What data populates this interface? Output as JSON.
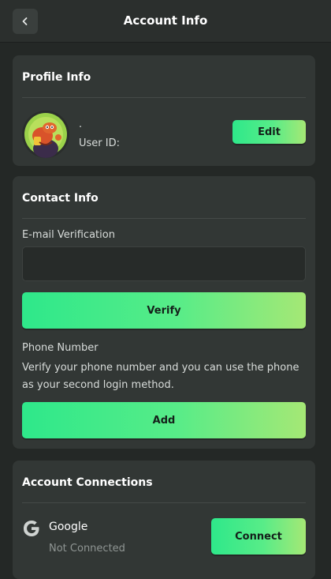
{
  "header": {
    "title": "Account Info",
    "back_icon": "chevron-left-icon"
  },
  "profile": {
    "section_title": "Profile Info",
    "avatar_icon": "cartoon-character-avatar",
    "name": ".",
    "user_id_label": "User ID:",
    "edit_label": "Edit"
  },
  "contact": {
    "section_title": "Contact Info",
    "email_label": "E-mail Verification",
    "email_value": "",
    "verify_label": "Verify",
    "phone_label": "Phone Number",
    "phone_description": "Verify your phone number and you can use the phone as your second login method.",
    "add_label": "Add"
  },
  "connections": {
    "section_title": "Account Connections",
    "items": [
      {
        "icon": "google-icon",
        "name": "Google",
        "status": "Not Connected",
        "button_label": "Connect"
      }
    ]
  },
  "colors": {
    "background": "#242826",
    "card": "#323735",
    "accent_start": "#2ee88a",
    "accent_end": "#a5e875"
  }
}
